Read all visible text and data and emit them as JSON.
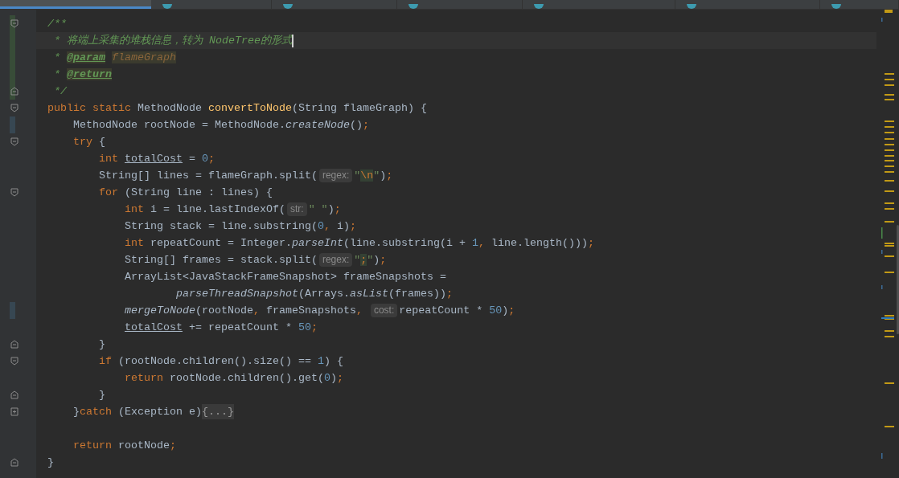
{
  "tabs": [
    {
      "selected": true
    },
    {
      "selected": false
    },
    {
      "selected": false
    },
    {
      "selected": false
    },
    {
      "selected": false
    },
    {
      "selected": false
    },
    {
      "selected": false
    }
  ],
  "lines": [
    {
      "current": false,
      "added": true,
      "modified": false,
      "fold_start": true,
      "fold_end": false,
      "folded": false,
      "tokens": [
        {
          "kind": "doc",
          "text": "/**"
        }
      ]
    },
    {
      "current": true,
      "added": true,
      "modified": false,
      "fold_start": false,
      "fold_end": false,
      "folded": false,
      "tokens": [
        {
          "kind": "doc",
          "text": " * 将端上采集的堆栈信息，转为 "
        },
        {
          "kind": "docitalic",
          "text": "NodeTree"
        },
        {
          "kind": "doc",
          "text": "的形式"
        }
      ]
    },
    {
      "current": false,
      "added": true,
      "modified": false,
      "fold_start": false,
      "fold_end": false,
      "folded": false,
      "tokens": [
        {
          "kind": "doc",
          "text": " * "
        },
        {
          "kind": "doctag",
          "text": "@param"
        },
        {
          "kind": "docparam",
          "text": "flameGraph"
        }
      ]
    },
    {
      "current": false,
      "added": true,
      "modified": false,
      "fold_start": false,
      "fold_end": false,
      "folded": false,
      "tokens": [
        {
          "kind": "doc",
          "text": " * "
        },
        {
          "kind": "doctag",
          "text": "@return"
        }
      ]
    },
    {
      "current": false,
      "added": true,
      "modified": false,
      "fold_start": false,
      "fold_end": true,
      "folded": false,
      "tokens": [
        {
          "kind": "doc",
          "text": " */"
        }
      ]
    },
    {
      "current": false,
      "added": false,
      "modified": false,
      "fold_start": true,
      "fold_end": false,
      "folded": false,
      "tokens": [
        {
          "kind": "kw",
          "text": "public static "
        },
        {
          "kind": "plain",
          "text": "MethodNode "
        },
        {
          "kind": "decl",
          "text": "convertToNode"
        },
        {
          "kind": "plain",
          "text": "(String flameGraph) {"
        }
      ]
    },
    {
      "current": false,
      "added": false,
      "modified": true,
      "fold_start": false,
      "fold_end": false,
      "folded": false,
      "tokens": [
        {
          "kind": "plain",
          "text": "    MethodNode rootNode = MethodNode."
        },
        {
          "kind": "italic",
          "text": "createNode"
        },
        {
          "kind": "plain",
          "text": "()"
        },
        {
          "kind": "kw",
          "text": ";"
        }
      ]
    },
    {
      "current": false,
      "added": false,
      "modified": false,
      "fold_start": true,
      "fold_end": false,
      "folded": false,
      "tokens": [
        {
          "kind": "kw",
          "text": "    try "
        },
        {
          "kind": "plain",
          "text": "{"
        }
      ]
    },
    {
      "current": false,
      "added": false,
      "modified": false,
      "fold_start": false,
      "fold_end": false,
      "folded": false,
      "tokens": [
        {
          "kind": "kw",
          "text": "        int "
        },
        {
          "kind": "ul",
          "text": "totalCost"
        },
        {
          "kind": "plain",
          "text": " = "
        },
        {
          "kind": "num",
          "text": "0"
        },
        {
          "kind": "kw",
          "text": ";"
        }
      ]
    },
    {
      "current": false,
      "added": false,
      "modified": false,
      "fold_start": false,
      "fold_end": false,
      "folded": false,
      "tokens": [
        {
          "kind": "plain",
          "text": "        String[] lines = flameGraph.split("
        },
        {
          "kind": "hint",
          "text": "regex:"
        },
        {
          "kind": "str",
          "text": "\""
        },
        {
          "kind": "esc",
          "text": "\\n"
        },
        {
          "kind": "str",
          "text": "\""
        },
        {
          "kind": "plain",
          "text": ")"
        },
        {
          "kind": "kw",
          "text": ";"
        }
      ]
    },
    {
      "current": false,
      "added": false,
      "modified": false,
      "fold_start": true,
      "fold_end": false,
      "folded": false,
      "tokens": [
        {
          "kind": "kw",
          "text": "        for "
        },
        {
          "kind": "plain",
          "text": "(String line : lines) {"
        }
      ]
    },
    {
      "current": false,
      "added": false,
      "modified": false,
      "fold_start": false,
      "fold_end": false,
      "folded": false,
      "tokens": [
        {
          "kind": "kw",
          "text": "            int "
        },
        {
          "kind": "plain",
          "text": "i = line.lastIndexOf("
        },
        {
          "kind": "hint",
          "text": "str:"
        },
        {
          "kind": "str",
          "text": "\" \""
        },
        {
          "kind": "plain",
          "text": ")"
        },
        {
          "kind": "kw",
          "text": ";"
        }
      ]
    },
    {
      "current": false,
      "added": false,
      "modified": false,
      "fold_start": false,
      "fold_end": false,
      "folded": false,
      "tokens": [
        {
          "kind": "plain",
          "text": "            String stack = line.substring("
        },
        {
          "kind": "num",
          "text": "0"
        },
        {
          "kind": "kw",
          "text": ", "
        },
        {
          "kind": "plain",
          "text": "i)"
        },
        {
          "kind": "kw",
          "text": ";"
        }
      ]
    },
    {
      "current": false,
      "added": false,
      "modified": false,
      "fold_start": false,
      "fold_end": false,
      "folded": false,
      "tokens": [
        {
          "kind": "kw",
          "text": "            int "
        },
        {
          "kind": "plain",
          "text": "repeatCount = Integer."
        },
        {
          "kind": "italic",
          "text": "parseInt"
        },
        {
          "kind": "plain",
          "text": "(line.substring(i + "
        },
        {
          "kind": "num",
          "text": "1"
        },
        {
          "kind": "kw",
          "text": ", "
        },
        {
          "kind": "plain",
          "text": "line.length()))"
        },
        {
          "kind": "kw",
          "text": ";"
        }
      ]
    },
    {
      "current": false,
      "added": false,
      "modified": false,
      "fold_start": false,
      "fold_end": false,
      "folded": false,
      "tokens": [
        {
          "kind": "plain",
          "text": "            String[] frames = stack.split("
        },
        {
          "kind": "hint",
          "text": "regex:"
        },
        {
          "kind": "str",
          "text": "\""
        },
        {
          "kind": "esc",
          "text": ";"
        },
        {
          "kind": "str",
          "text": "\""
        },
        {
          "kind": "plain",
          "text": ")"
        },
        {
          "kind": "kw",
          "text": ";"
        }
      ]
    },
    {
      "current": false,
      "added": false,
      "modified": false,
      "fold_start": false,
      "fold_end": false,
      "folded": false,
      "tokens": [
        {
          "kind": "plain",
          "text": "            ArrayList<JavaStackFrameSnapshot> frameSnapshots ="
        }
      ]
    },
    {
      "current": false,
      "added": false,
      "modified": false,
      "fold_start": false,
      "fold_end": false,
      "folded": false,
      "tokens": [
        {
          "kind": "italic",
          "text": "                    parseThreadSnapshot"
        },
        {
          "kind": "plain",
          "text": "(Arrays."
        },
        {
          "kind": "italic",
          "text": "asList"
        },
        {
          "kind": "plain",
          "text": "(frames))"
        },
        {
          "kind": "kw",
          "text": ";"
        }
      ]
    },
    {
      "current": false,
      "added": false,
      "modified": true,
      "fold_start": false,
      "fold_end": false,
      "folded": false,
      "tokens": [
        {
          "kind": "italic",
          "text": "            mergeToNode"
        },
        {
          "kind": "plain",
          "text": "(rootNode"
        },
        {
          "kind": "kw",
          "text": ", "
        },
        {
          "kind": "plain",
          "text": "frameSnapshots"
        },
        {
          "kind": "kw",
          "text": ", "
        },
        {
          "kind": "hint",
          "text": "cost:"
        },
        {
          "kind": "plain",
          "text": "repeatCount * "
        },
        {
          "kind": "num",
          "text": "50"
        },
        {
          "kind": "plain",
          "text": ")"
        },
        {
          "kind": "kw",
          "text": ";"
        }
      ]
    },
    {
      "current": false,
      "added": false,
      "modified": false,
      "fold_start": false,
      "fold_end": false,
      "folded": false,
      "tokens": [
        {
          "kind": "ul",
          "text": "            totalCost"
        },
        {
          "kind": "plain",
          "text": " += repeatCount * "
        },
        {
          "kind": "num",
          "text": "50"
        },
        {
          "kind": "kw",
          "text": ";"
        }
      ]
    },
    {
      "current": false,
      "added": false,
      "modified": false,
      "fold_start": false,
      "fold_end": true,
      "folded": false,
      "tokens": [
        {
          "kind": "plain",
          "text": "        }"
        }
      ]
    },
    {
      "current": false,
      "added": false,
      "modified": false,
      "fold_start": true,
      "fold_end": false,
      "folded": false,
      "tokens": [
        {
          "kind": "kw",
          "text": "        if "
        },
        {
          "kind": "plain",
          "text": "(rootNode.children().size() == "
        },
        {
          "kind": "num",
          "text": "1"
        },
        {
          "kind": "plain",
          "text": ") {"
        }
      ]
    },
    {
      "current": false,
      "added": false,
      "modified": false,
      "fold_start": false,
      "fold_end": false,
      "folded": false,
      "tokens": [
        {
          "kind": "kw",
          "text": "            return "
        },
        {
          "kind": "plain",
          "text": "rootNode.children().get("
        },
        {
          "kind": "num",
          "text": "0"
        },
        {
          "kind": "plain",
          "text": ")"
        },
        {
          "kind": "kw",
          "text": ";"
        }
      ]
    },
    {
      "current": false,
      "added": false,
      "modified": false,
      "fold_start": false,
      "fold_end": true,
      "folded": false,
      "tokens": [
        {
          "kind": "plain",
          "text": "        }"
        }
      ]
    },
    {
      "current": false,
      "added": false,
      "modified": false,
      "fold_start": false,
      "fold_end": false,
      "folded": true,
      "tokens": [
        {
          "kind": "plain",
          "text": "    }"
        },
        {
          "kind": "kw",
          "text": "catch "
        },
        {
          "kind": "plain",
          "text": "(Exception e)"
        },
        {
          "kind": "fold",
          "text": "{...}"
        }
      ]
    },
    {
      "current": false,
      "added": false,
      "modified": false,
      "fold_start": false,
      "fold_end": false,
      "folded": false
    },
    {
      "current": false,
      "added": false,
      "modified": false,
      "fold_start": false,
      "fold_end": false,
      "folded": false,
      "tokens": [
        {
          "kind": "kw",
          "text": "    return "
        },
        {
          "kind": "plain",
          "text": "rootNode"
        },
        {
          "kind": "kw",
          "text": ";"
        }
      ]
    },
    {
      "current": false,
      "added": false,
      "modified": false,
      "fold_start": false,
      "fold_end": true,
      "folded": false,
      "tokens": [
        {
          "kind": "plain",
          "text": "}"
        }
      ]
    }
  ]
}
